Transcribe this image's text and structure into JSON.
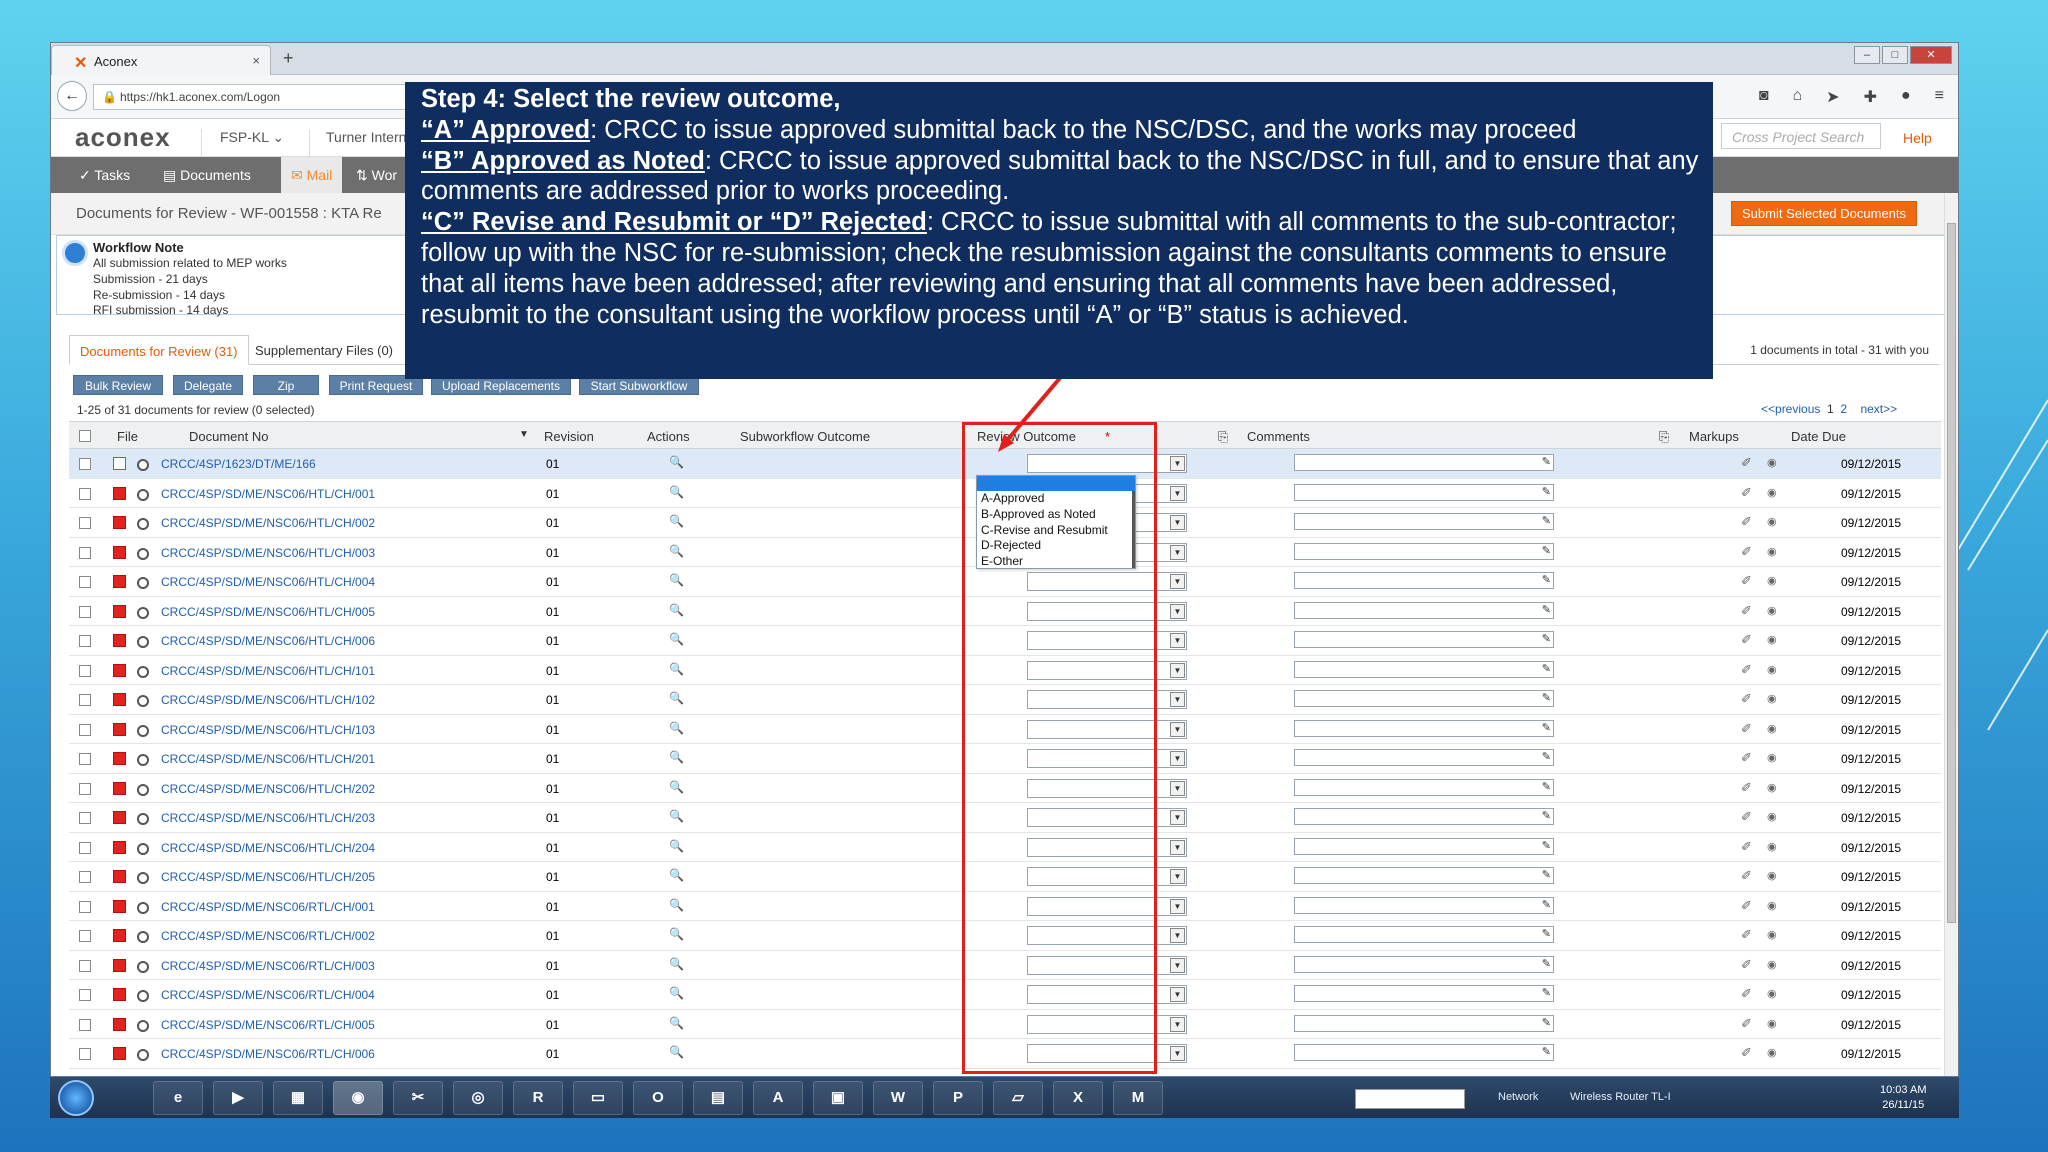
{
  "browser": {
    "tab_title": "Aconex",
    "url": "https://hk1.aconex.com/Logon",
    "tab_close": "×",
    "new_tab": "+"
  },
  "app": {
    "logo": "aconex",
    "project": "FSP-KL",
    "organization": "Turner Intern",
    "cross_project_search": "Cross Project Search",
    "help": "Help"
  },
  "menu": {
    "tasks": "Tasks",
    "documents": "Documents",
    "mail": "Mail",
    "workflows": "Wor"
  },
  "page": {
    "title": "Documents for Review - WF-001558 : KTA Re",
    "submit_button": "Submit Selected Documents"
  },
  "workflow_note": {
    "title": "Workflow Note",
    "lines": [
      "All submission related to MEP works",
      "Submission - 21 days",
      "Re-submission - 14 days",
      "RFI submission - 14 days"
    ]
  },
  "subtabs": {
    "review": "Documents for Review (31)",
    "supplementary": "Supplementary Files (0)",
    "total": "1 documents in total - 31  with you"
  },
  "actions": {
    "bulk_review": "Bulk Review",
    "delegate": "Delegate",
    "zip": "Zip",
    "print_request": "Print Request",
    "upload_replacements": "Upload Replacements",
    "start_subworkflow": "Start Subworkflow"
  },
  "list_info": {
    "range": "1-25 of 31  documents for review  (0 selected)",
    "previous": "<<previous",
    "page1": "1",
    "page2": "2",
    "next": "next>>"
  },
  "columns": {
    "file": "File",
    "document_no": "Document No",
    "revision": "Revision",
    "actions": "Actions",
    "subworkflow_outcome": "Subworkflow Outcome",
    "review_outcome": "Review Outcome",
    "comments": "Comments",
    "markups": "Markups",
    "date_due": "Date Due"
  },
  "rows": [
    {
      "doc": "CRCC/4SP/1623/DT/ME/166",
      "rev": "01",
      "due": "09/12/2015"
    },
    {
      "doc": "CRCC/4SP/SD/ME/NSC06/HTL/CH/001",
      "rev": "01",
      "due": "09/12/2015"
    },
    {
      "doc": "CRCC/4SP/SD/ME/NSC06/HTL/CH/002",
      "rev": "01",
      "due": "09/12/2015"
    },
    {
      "doc": "CRCC/4SP/SD/ME/NSC06/HTL/CH/003",
      "rev": "01",
      "due": "09/12/2015"
    },
    {
      "doc": "CRCC/4SP/SD/ME/NSC06/HTL/CH/004",
      "rev": "01",
      "due": "09/12/2015"
    },
    {
      "doc": "CRCC/4SP/SD/ME/NSC06/HTL/CH/005",
      "rev": "01",
      "due": "09/12/2015"
    },
    {
      "doc": "CRCC/4SP/SD/ME/NSC06/HTL/CH/006",
      "rev": "01",
      "due": "09/12/2015"
    },
    {
      "doc": "CRCC/4SP/SD/ME/NSC06/HTL/CH/101",
      "rev": "01",
      "due": "09/12/2015"
    },
    {
      "doc": "CRCC/4SP/SD/ME/NSC06/HTL/CH/102",
      "rev": "01",
      "due": "09/12/2015"
    },
    {
      "doc": "CRCC/4SP/SD/ME/NSC06/HTL/CH/103",
      "rev": "01",
      "due": "09/12/2015"
    },
    {
      "doc": "CRCC/4SP/SD/ME/NSC06/HTL/CH/201",
      "rev": "01",
      "due": "09/12/2015"
    },
    {
      "doc": "CRCC/4SP/SD/ME/NSC06/HTL/CH/202",
      "rev": "01",
      "due": "09/12/2015"
    },
    {
      "doc": "CRCC/4SP/SD/ME/NSC06/HTL/CH/203",
      "rev": "01",
      "due": "09/12/2015"
    },
    {
      "doc": "CRCC/4SP/SD/ME/NSC06/HTL/CH/204",
      "rev": "01",
      "due": "09/12/2015"
    },
    {
      "doc": "CRCC/4SP/SD/ME/NSC06/HTL/CH/205",
      "rev": "01",
      "due": "09/12/2015"
    },
    {
      "doc": "CRCC/4SP/SD/ME/NSC06/RTL/CH/001",
      "rev": "01",
      "due": "09/12/2015"
    },
    {
      "doc": "CRCC/4SP/SD/ME/NSC06/RTL/CH/002",
      "rev": "01",
      "due": "09/12/2015"
    },
    {
      "doc": "CRCC/4SP/SD/ME/NSC06/RTL/CH/003",
      "rev": "01",
      "due": "09/12/2015"
    },
    {
      "doc": "CRCC/4SP/SD/ME/NSC06/RTL/CH/004",
      "rev": "01",
      "due": "09/12/2015"
    },
    {
      "doc": "CRCC/4SP/SD/ME/NSC06/RTL/CH/005",
      "rev": "01",
      "due": "09/12/2015"
    },
    {
      "doc": "CRCC/4SP/SD/ME/NSC06/RTL/CH/006",
      "rev": "01",
      "due": "09/12/2015"
    }
  ],
  "dropdown_options": [
    "A-Approved",
    "B-Approved as Noted",
    "C-Revise and Resubmit",
    "D-Rejected",
    "E-Other"
  ],
  "callout": {
    "step": "Step 4: Select the review outcome,",
    "a_key": "“A” Approved",
    "a_text": ": CRCC to issue approved submittal back to the NSC/DSC, and the works may proceed",
    "b_key": "“B” Approved as Noted",
    "b_text": ": CRCC to issue approved submittal back to the NSC/DSC in full, and to ensure that any comments are addressed prior to works proceeding.",
    "c_key": "“C” Revise and Resubmit or “D” Rejected",
    "c_text": ": CRCC to issue submittal with all comments to the sub-contractor; follow up with the NSC for re-submission; check the resubmission against the consultants comments to ensure that all items have been addressed; after reviewing and ensuring that all comments have been addressed, resubmit to the consultant using the workflow process until “A” or “B” status is achieved."
  },
  "taskbar": {
    "network": "Network",
    "router": "Wireless Router TL-I",
    "time": "10:03 AM",
    "date": "26/11/15"
  },
  "colors": {
    "accent": "#e8590c",
    "callout_bg": "#0f2d5e",
    "highlight_red": "#e0211b",
    "link_blue": "#1f5fb0"
  }
}
